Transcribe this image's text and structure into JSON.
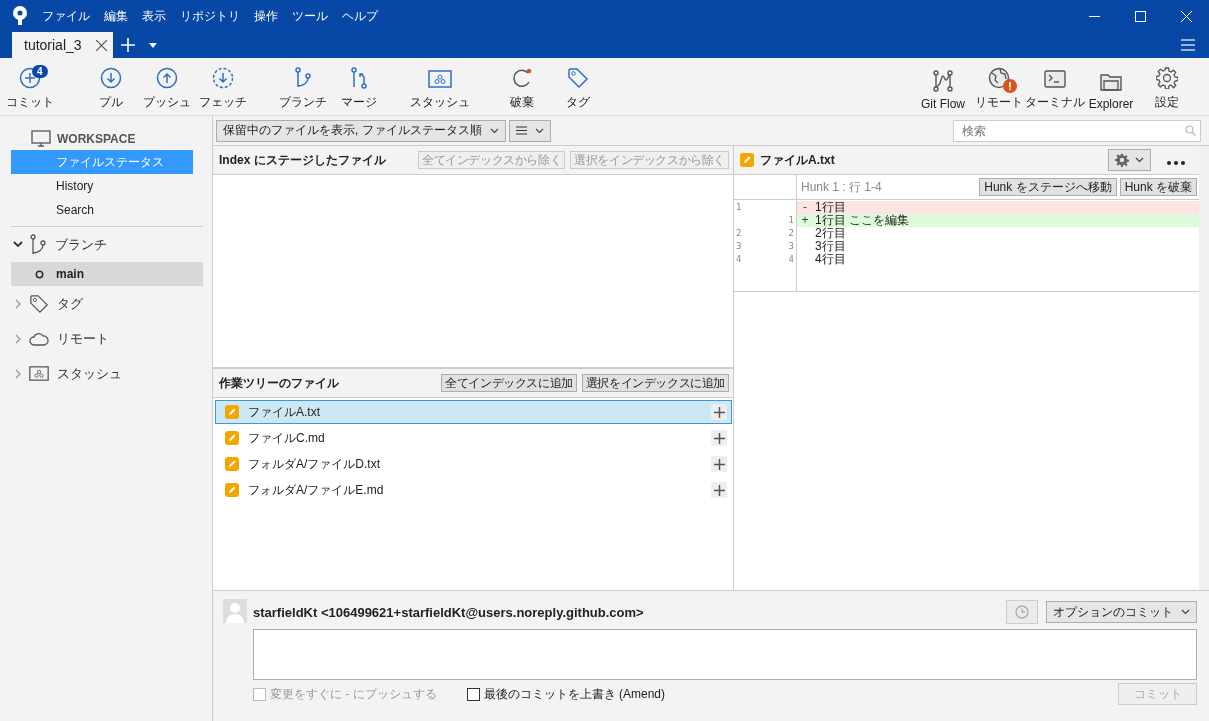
{
  "menu": [
    "ファイル",
    "編集",
    "表示",
    "リポジトリ",
    "操作",
    "ツール",
    "ヘルプ"
  ],
  "tabs": [
    {
      "label": "tutorial_3",
      "selected": true
    }
  ],
  "toolbar": [
    {
      "label": "コミット",
      "badge": "4"
    },
    {
      "label": "プル"
    },
    {
      "label": "プッシュ"
    },
    {
      "label": "フェッチ"
    },
    {
      "label": "ブランチ"
    },
    {
      "label": "マージ"
    },
    {
      "label": "スタッシュ"
    },
    {
      "label": "破棄"
    },
    {
      "label": "タグ"
    }
  ],
  "toolbar_right": [
    {
      "label": "Git Flow",
      "warning": false
    },
    {
      "label": "リモート",
      "warning": true
    },
    {
      "label": "ターミナル",
      "warning": false
    },
    {
      "label": "Explorer",
      "warning": false
    },
    {
      "label": "設定",
      "warning": false
    }
  ],
  "sidebar": {
    "workspace": "WORKSPACE",
    "items": [
      {
        "label": "ファイルステータス",
        "selected": true
      },
      {
        "label": "History",
        "selected": false
      },
      {
        "label": "Search",
        "selected": false
      }
    ],
    "sections": [
      {
        "label": "ブランチ",
        "expanded": true,
        "children": [
          {
            "label": "main",
            "selected": true
          }
        ]
      },
      {
        "label": "タグ",
        "expanded": false
      },
      {
        "label": "リモート",
        "expanded": false
      },
      {
        "label": "スタッシュ",
        "expanded": false
      }
    ]
  },
  "filter": {
    "label": "保留中のファイルを表示, ファイルステータス順"
  },
  "search": {
    "placeholder": "検索"
  },
  "staged": {
    "title": "Index にステージしたファイル",
    "buttons": [
      {
        "label": "全てインデックスから除く",
        "disabled": true
      },
      {
        "label": "選択をインデックスから除く",
        "disabled": true
      }
    ]
  },
  "unstaged": {
    "title": "作業ツリーのファイル",
    "buttons": [
      {
        "label": "全てインデックスに追加",
        "disabled": false
      },
      {
        "label": "選択をインデックスに追加",
        "disabled": false
      }
    ],
    "files": [
      {
        "name": "ファイルA.txt",
        "selected": true
      },
      {
        "name": "ファイルC.md",
        "selected": false
      },
      {
        "name": "フォルダA/ファイルD.txt",
        "selected": false
      },
      {
        "name": "フォルダA/ファイルE.md",
        "selected": false
      }
    ]
  },
  "diff": {
    "file": "ファイルA.txt",
    "hunk": "Hunk 1 : 行 1-4",
    "hunk_buttons": [
      "Hunk をステージへ移動",
      "Hunk を破棄"
    ],
    "lines": [
      {
        "kind": "removed",
        "old": "1",
        "sign": "-",
        "text": "1行目"
      },
      {
        "kind": "added",
        "new": "1",
        "sign": "+",
        "text": "1行目  ここを編集"
      },
      {
        "kind": "context",
        "old": "2",
        "new": "2",
        "text": "2行目"
      },
      {
        "kind": "context",
        "old": "3",
        "new": "3",
        "text": "3行目"
      },
      {
        "kind": "context",
        "old": "4",
        "new": "4",
        "text": "4行目"
      }
    ]
  },
  "commit": {
    "author": "starfieldKt <106499621+starfieldKt@users.noreply.github.com>",
    "options": "オプションのコミット",
    "checkboxes": [
      {
        "label": "変更をすぐに - にプッシュする",
        "checked": false,
        "disabled": true
      },
      {
        "label": "最後のコミットを上書き (Amend)",
        "checked": false,
        "disabled": false
      }
    ],
    "button": {
      "label": "コミット",
      "disabled": true
    }
  }
}
